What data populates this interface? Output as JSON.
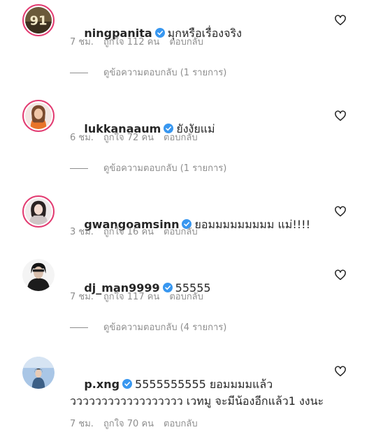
{
  "comments": [
    {
      "username": "ningpanita",
      "text": "มุกหรือเรื่องจริง",
      "time": "7 ชม.",
      "likes": "ถูกใจ 112 คน",
      "reply": "ตอบกลับ",
      "view_replies": "ดูข้อความตอบกลับ (1 รายการ)",
      "avatar_text": "91"
    },
    {
      "username": "lukkanaaum",
      "text": "ยังงัยแม่",
      "time": "6 ชม.",
      "likes": "ถูกใจ 72 คน",
      "reply": "ตอบกลับ",
      "view_replies": "ดูข้อความตอบกลับ (1 รายการ)"
    },
    {
      "username": "gwangoamsinn",
      "text": "ยอมมมมมมมมม แม่!!!!",
      "time": "3 ชม.",
      "likes": "ถูกใจ 16 คน",
      "reply": "ตอบกลับ"
    },
    {
      "username": "dj_man9999",
      "text": "55555",
      "time": "7 ชม.",
      "likes": "ถูกใจ 117 คน",
      "reply": "ตอบกลับ",
      "view_replies": "ดูข้อความตอบกลับ (4 รายการ)"
    },
    {
      "username": "p.xng",
      "text": "5555555555 ยอมมมมแล้ว วววววววววววววววววว เวทมู จะมีน้องอีกแล้ว1 งงนะ",
      "time": "7 ชม.",
      "likes": "ถูกใจ 70 คน",
      "reply": "ตอบกลับ"
    }
  ],
  "colors": {
    "verified": "#3897f0",
    "meta": "#8e8e8e",
    "ring": "#e23b71"
  },
  "icons": {
    "verified": "verified-badge-icon",
    "like": "heart-outline-icon"
  }
}
